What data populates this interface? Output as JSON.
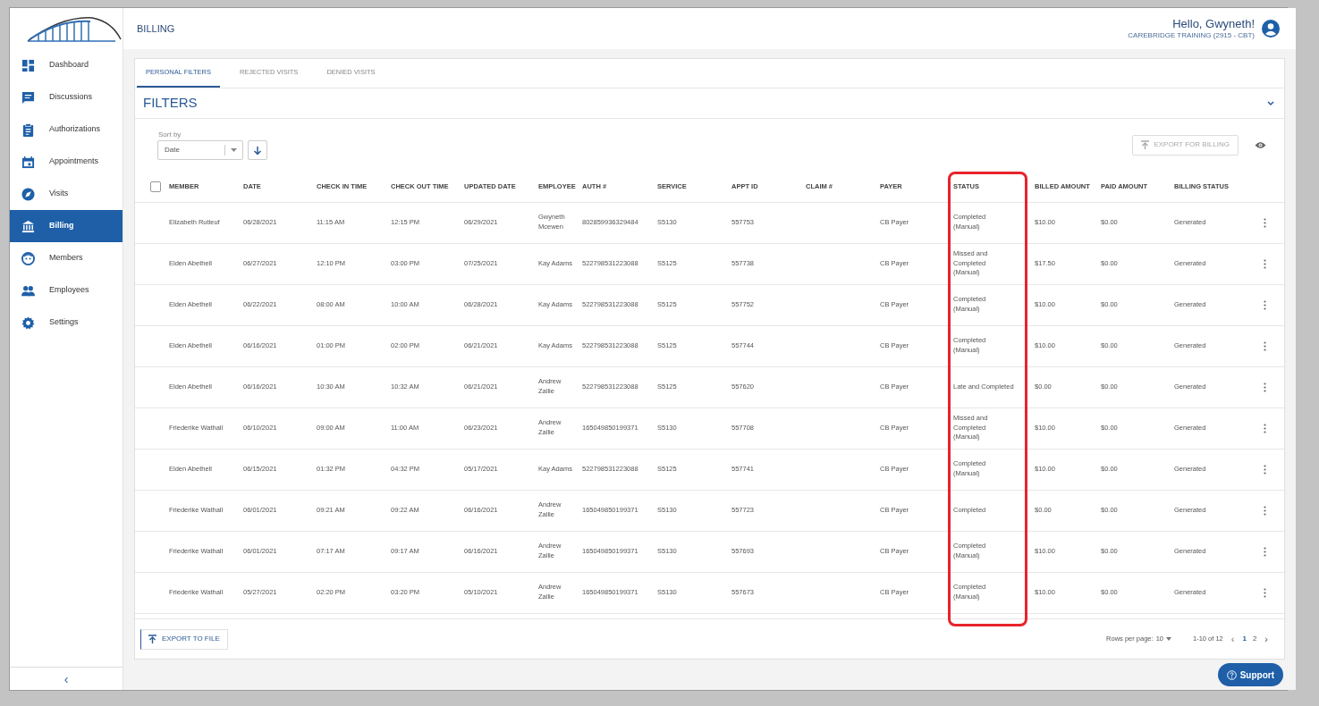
{
  "header": {
    "title": "BILLING",
    "greeting": "Hello, Gwyneth!",
    "organization": "CAREBRIDGE TRAINING (2915 - CBT)"
  },
  "sidebar": {
    "items": [
      {
        "label": "Dashboard",
        "selected": false
      },
      {
        "label": "Discussions",
        "selected": false
      },
      {
        "label": "Authorizations",
        "selected": false
      },
      {
        "label": "Appointments",
        "selected": false
      },
      {
        "label": "Visits",
        "selected": false
      },
      {
        "label": "Billing",
        "selected": true
      },
      {
        "label": "Members",
        "selected": false
      },
      {
        "label": "Employees",
        "selected": false
      },
      {
        "label": "Settings",
        "selected": false
      }
    ],
    "collapse": "‹"
  },
  "tabs": [
    {
      "label": "PERSONAL FILTERS",
      "selected": true
    },
    {
      "label": "REJECTED VISITS",
      "selected": false
    },
    {
      "label": "DENIED VISITS",
      "selected": false
    }
  ],
  "filters": {
    "title": "FILTERS",
    "expanded": false
  },
  "sort": {
    "label": "Sort by",
    "value": "Date"
  },
  "export_billing": {
    "label": "EXPORT FOR BILLING",
    "disabled": true
  },
  "table": {
    "select_all": {
      "checked": false
    },
    "columns": [
      {
        "label": "MEMBER",
        "highlighted": false
      },
      {
        "label": "DATE",
        "highlighted": false
      },
      {
        "label": "CHECK IN TIME",
        "highlighted": false
      },
      {
        "label": "CHECK OUT TIME",
        "highlighted": false
      },
      {
        "label": "UPDATED DATE",
        "highlighted": false
      },
      {
        "label": "EMPLOYEE",
        "highlighted": false
      },
      {
        "label": "AUTH #",
        "highlighted": false
      },
      {
        "label": "SERVICE",
        "highlighted": false
      },
      {
        "label": "APPT ID",
        "highlighted": false
      },
      {
        "label": "CLAIM #",
        "highlighted": false
      },
      {
        "label": "PAYER",
        "highlighted": false
      },
      {
        "label": "STATUS",
        "highlighted": true
      },
      {
        "label": "BILLED AMOUNT",
        "highlighted": false
      },
      {
        "label": "PAID AMOUNT",
        "highlighted": false
      },
      {
        "label": "BILLING STATUS",
        "highlighted": false
      }
    ],
    "rows": [
      {
        "cells": [
          "Elizabeth Rutleuf",
          "06/28/2021",
          "11:15 AM",
          "12:15 PM",
          "06/29/2021",
          "Gwyneth\nMcewen",
          "802859936329484",
          "S5130",
          "557753",
          "",
          "CB Payer",
          "Completed\n(Manual)",
          "$10.00",
          "$0.00",
          "Generated"
        ]
      },
      {
        "cells": [
          "Elden Abethell",
          "06/27/2021",
          "12:10 PM",
          "03:00 PM",
          "07/25/2021",
          "Kay Adams",
          "522798531223088",
          "S5125",
          "557738",
          "",
          "CB Payer",
          "Missed and\nCompleted\n(Manual)",
          "$17.50",
          "$0.00",
          "Generated"
        ]
      },
      {
        "cells": [
          "Elden Abethell",
          "06/22/2021",
          "08:00 AM",
          "10:00 AM",
          "06/28/2021",
          "Kay Adams",
          "522798531223088",
          "S5125",
          "557752",
          "",
          "CB Payer",
          "Completed\n(Manual)",
          "$10.00",
          "$0.00",
          "Generated"
        ]
      },
      {
        "cells": [
          "Elden Abethell",
          "06/16/2021",
          "01:00 PM",
          "02:00 PM",
          "06/21/2021",
          "Kay Adams",
          "522798531223088",
          "S5125",
          "557744",
          "",
          "CB Payer",
          "Completed\n(Manual)",
          "$10.00",
          "$0.00",
          "Generated"
        ]
      },
      {
        "cells": [
          "Elden Abethell",
          "06/16/2021",
          "10:30 AM",
          "10:32 AM",
          "06/21/2021",
          "Andrew\nZallie",
          "522798531223088",
          "S5125",
          "557620",
          "",
          "CB Payer",
          "Late and Completed",
          "$0.00",
          "$0.00",
          "Generated"
        ]
      },
      {
        "cells": [
          "Friederike Wathall",
          "06/10/2021",
          "09:00 AM",
          "11:00 AM",
          "06/23/2021",
          "Andrew\nZallie",
          "165049850199371",
          "S5130",
          "557708",
          "",
          "CB Payer",
          "Missed and\nCompleted\n(Manual)",
          "$10.00",
          "$0.00",
          "Generated"
        ]
      },
      {
        "cells": [
          "Elden Abethell",
          "06/15/2021",
          "01:32 PM",
          "04:32 PM",
          "05/17/2021",
          "Kay Adams",
          "522798531223088",
          "S5125",
          "557741",
          "",
          "CB Payer",
          "Completed\n(Manual)",
          "$10.00",
          "$0.00",
          "Generated"
        ]
      },
      {
        "cells": [
          "Friederike Wathall",
          "06/01/2021",
          "09:21 AM",
          "09:22 AM",
          "06/16/2021",
          "Andrew\nZallie",
          "165049850199371",
          "S5130",
          "557723",
          "",
          "CB Payer",
          "Completed",
          "$0.00",
          "$0.00",
          "Generated"
        ]
      },
      {
        "cells": [
          "Friederike Wathall",
          "06/01/2021",
          "07:17 AM",
          "09:17 AM",
          "06/16/2021",
          "Andrew\nZallie",
          "165049850199371",
          "S5130",
          "557693",
          "",
          "CB Payer",
          "Completed\n(Manual)",
          "$10.00",
          "$0.00",
          "Generated"
        ]
      },
      {
        "cells": [
          "Friederike Wathall",
          "05/27/2021",
          "02:20 PM",
          "03:20 PM",
          "05/10/2021",
          "Andrew\nZallie",
          "165049850199371",
          "S5130",
          "557673",
          "",
          "CB Payer",
          "Completed\n(Manual)",
          "$10.00",
          "$0.00",
          "Generated"
        ]
      }
    ]
  },
  "footer": {
    "export_file": "EXPORT TO FILE",
    "rows_per_page_label": "Rows per page:",
    "rows_per_page": "10",
    "range": "1-10 of 12",
    "pages": [
      {
        "label": "1",
        "selected": true
      },
      {
        "label": "2",
        "selected": false
      }
    ],
    "prev": "‹",
    "next": "›"
  },
  "support": "Support"
}
